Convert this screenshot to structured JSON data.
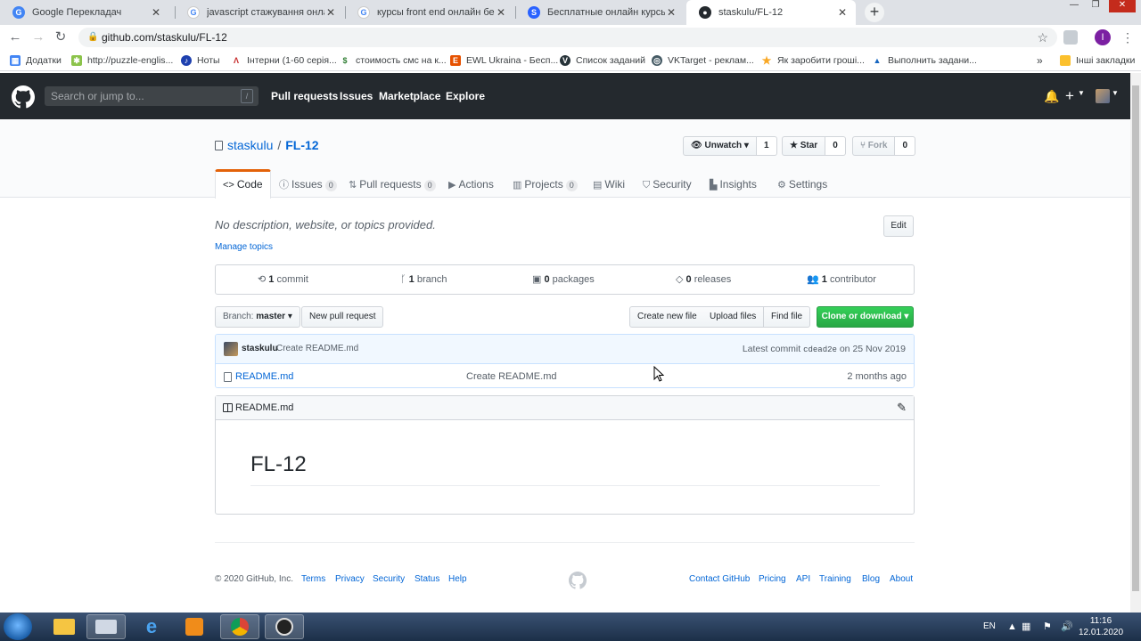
{
  "browser": {
    "tabs": [
      {
        "title": "Google Перекладач",
        "favicon": "google-translate-icon",
        "color": "#4285f4",
        "active": false
      },
      {
        "title": "javascript стажування онлайн -",
        "favicon": "google-icon",
        "color": "#ea4335",
        "active": false
      },
      {
        "title": "курсы front end онлайн беспла",
        "favicon": "google-icon",
        "color": "#ea4335",
        "active": false
      },
      {
        "title": "Бесплатные онлайн курсы Front",
        "favicon": "site-icon",
        "color": "#2962ff",
        "active": false
      },
      {
        "title": "staskulu/FL-12",
        "favicon": "github-icon",
        "color": "#24292e",
        "active": true
      }
    ],
    "url": "github.com/staskulu/FL-12",
    "profile_initial": "I",
    "bookmarks": [
      {
        "label": "Додатки",
        "icon": "apps-icon",
        "color": "#4285f4"
      },
      {
        "label": "http://puzzle-englis...",
        "icon": "puzzle-icon",
        "color": "#8bc34a"
      },
      {
        "label": "Ноты",
        "icon": "music-icon",
        "color": "#1e40af"
      },
      {
        "label": "Інтерни (1-60 серія...",
        "icon": "series-icon",
        "color": "#c62828"
      },
      {
        "label": "стоимость смс на к...",
        "icon": "sms-icon",
        "color": "#37474f"
      },
      {
        "label": "EWL Ukraina - Бесп...",
        "icon": "ewl-icon",
        "color": "#e65100"
      },
      {
        "label": "Список заданий",
        "icon": "tasks-icon",
        "color": "#263238"
      },
      {
        "label": "VKTarget - реклам...",
        "icon": "vktarget-icon",
        "color": "#455a64"
      },
      {
        "label": "Як заробити гроші...",
        "icon": "star-icon",
        "color": "#f9a825"
      },
      {
        "label": "Выполнить задани...",
        "icon": "triangle-icon",
        "color": "#1565c0"
      }
    ],
    "bookmarks_more": "»",
    "other_bookmarks": "Інші закладки"
  },
  "github_header": {
    "search_placeholder": "Search or jump to...",
    "search_key": "/",
    "nav": [
      "Pull requests",
      "Issues",
      "Marketplace",
      "Explore"
    ]
  },
  "repo": {
    "owner": "staskulu",
    "separator": "/",
    "name": "FL-12",
    "watch_label": "Unwatch",
    "watch_count": "1",
    "star_label": "Star",
    "star_count": "0",
    "fork_label": "Fork",
    "fork_count": "0",
    "tabs": [
      {
        "label": "Code",
        "icon": "code-icon",
        "count": null,
        "selected": true
      },
      {
        "label": "Issues",
        "icon": "issue-icon",
        "count": "0"
      },
      {
        "label": "Pull requests",
        "icon": "pull-request-icon",
        "count": "0"
      },
      {
        "label": "Actions",
        "icon": "play-icon",
        "count": null
      },
      {
        "label": "Projects",
        "icon": "project-icon",
        "count": "0"
      },
      {
        "label": "Wiki",
        "icon": "book-icon",
        "count": null
      },
      {
        "label": "Security",
        "icon": "shield-icon",
        "count": null
      },
      {
        "label": "Insights",
        "icon": "graph-icon",
        "count": null
      },
      {
        "label": "Settings",
        "icon": "gear-icon",
        "count": null
      }
    ],
    "description": "No description, website, or topics provided.",
    "manage_topics": "Manage topics",
    "edit_label": "Edit",
    "summary": [
      {
        "icon": "history-icon",
        "value": "1",
        "label": "commit"
      },
      {
        "icon": "branch-icon",
        "value": "1",
        "label": "branch"
      },
      {
        "icon": "package-icon",
        "value": "0",
        "label": "packages"
      },
      {
        "icon": "tag-icon",
        "value": "0",
        "label": "releases"
      },
      {
        "icon": "people-icon",
        "value": "1",
        "label": "contributor"
      }
    ],
    "branch_label": "Branch:",
    "branch_value": "master",
    "new_pull_request": "New pull request",
    "create_new_file": "Create new file",
    "upload_files": "Upload files",
    "find_file": "Find file",
    "clone_download": "Clone or download",
    "commit": {
      "author": "staskulu",
      "message": "Create README.md",
      "latest_label": "Latest commit",
      "sha": "cdead2e",
      "date_prefix": "on",
      "date": "25 Nov 2019"
    },
    "files": [
      {
        "name": "README.md",
        "message": "Create README.md",
        "age": "2 months ago"
      }
    ],
    "readme_title": "README.md",
    "readme_heading": "FL-12"
  },
  "footer": {
    "copyright": "© 2020 GitHub, Inc.",
    "left_links": [
      "Terms",
      "Privacy",
      "Security",
      "Status",
      "Help"
    ],
    "right_links": [
      "Contact GitHub",
      "Pricing",
      "API",
      "Training",
      "Blog",
      "About"
    ]
  },
  "taskbar": {
    "language": "EN",
    "time": "11:16",
    "date": "12.01.2020"
  }
}
